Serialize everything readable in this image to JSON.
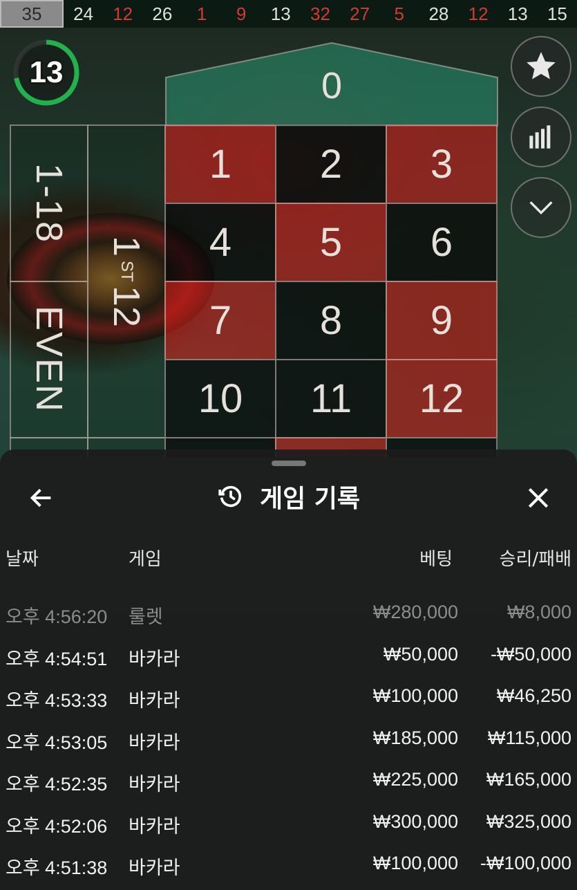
{
  "results": [
    {
      "value": "35",
      "color": "black"
    },
    {
      "value": "24",
      "color": "black"
    },
    {
      "value": "12",
      "color": "red"
    },
    {
      "value": "26",
      "color": "black"
    },
    {
      "value": "1",
      "color": "red"
    },
    {
      "value": "9",
      "color": "red"
    },
    {
      "value": "13",
      "color": "black"
    },
    {
      "value": "32",
      "color": "red"
    },
    {
      "value": "27",
      "color": "red"
    },
    {
      "value": "5",
      "color": "red"
    },
    {
      "value": "28",
      "color": "black"
    },
    {
      "value": "12",
      "color": "red"
    },
    {
      "value": "13",
      "color": "black"
    },
    {
      "value": "15",
      "color": "black"
    }
  ],
  "timer": {
    "value": "13",
    "progress": 0.72,
    "color": "#22b14c"
  },
  "side_buttons": [
    {
      "name": "favorite-button",
      "icon": "star-icon"
    },
    {
      "name": "statistics-button",
      "icon": "bar-chart-icon"
    },
    {
      "name": "collapse-button",
      "icon": "chevron-down-icon"
    }
  ],
  "board": {
    "zero": "0",
    "low": "1-18",
    "even": "EVEN",
    "dozen_num": "1",
    "dozen_suffix": "ST",
    "dozen_num2": "12",
    "numbers": [
      {
        "n": "1",
        "color": "red"
      },
      {
        "n": "2",
        "color": "black"
      },
      {
        "n": "3",
        "color": "red"
      },
      {
        "n": "4",
        "color": "black"
      },
      {
        "n": "5",
        "color": "red"
      },
      {
        "n": "6",
        "color": "black"
      },
      {
        "n": "7",
        "color": "red"
      },
      {
        "n": "8",
        "color": "black"
      },
      {
        "n": "9",
        "color": "red"
      },
      {
        "n": "10",
        "color": "black"
      },
      {
        "n": "11",
        "color": "black"
      },
      {
        "n": "12",
        "color": "red"
      }
    ],
    "colors": {
      "red": "#c81e1a",
      "black": "#080808",
      "zero": "#2a8a6a"
    }
  },
  "sheet": {
    "title": "게임 기록",
    "columns": {
      "date": "날짜",
      "game": "게임",
      "bet": "베팅",
      "result": "승리/패배"
    },
    "rows": [
      {
        "date": "오후 4:56:20",
        "game": "룰렛",
        "bet": "₩280,000",
        "result": "₩8,000",
        "dim": true
      },
      {
        "date": "오후 4:54:51",
        "game": "바카라",
        "bet": "₩50,000",
        "result": "-₩50,000",
        "dim": false
      },
      {
        "date": "오후 4:53:33",
        "game": "바카라",
        "bet": "₩100,000",
        "result": "₩46,250",
        "dim": false
      },
      {
        "date": "오후 4:53:05",
        "game": "바카라",
        "bet": "₩185,000",
        "result": "₩115,000",
        "dim": false
      },
      {
        "date": "오후 4:52:35",
        "game": "바카라",
        "bet": "₩225,000",
        "result": "₩165,000",
        "dim": false
      },
      {
        "date": "오후 4:52:06",
        "game": "바카라",
        "bet": "₩300,000",
        "result": "₩325,000",
        "dim": false
      },
      {
        "date": "오후 4:51:38",
        "game": "바카라",
        "bet": "₩100,000",
        "result": "-₩100,000",
        "dim": false
      }
    ]
  }
}
